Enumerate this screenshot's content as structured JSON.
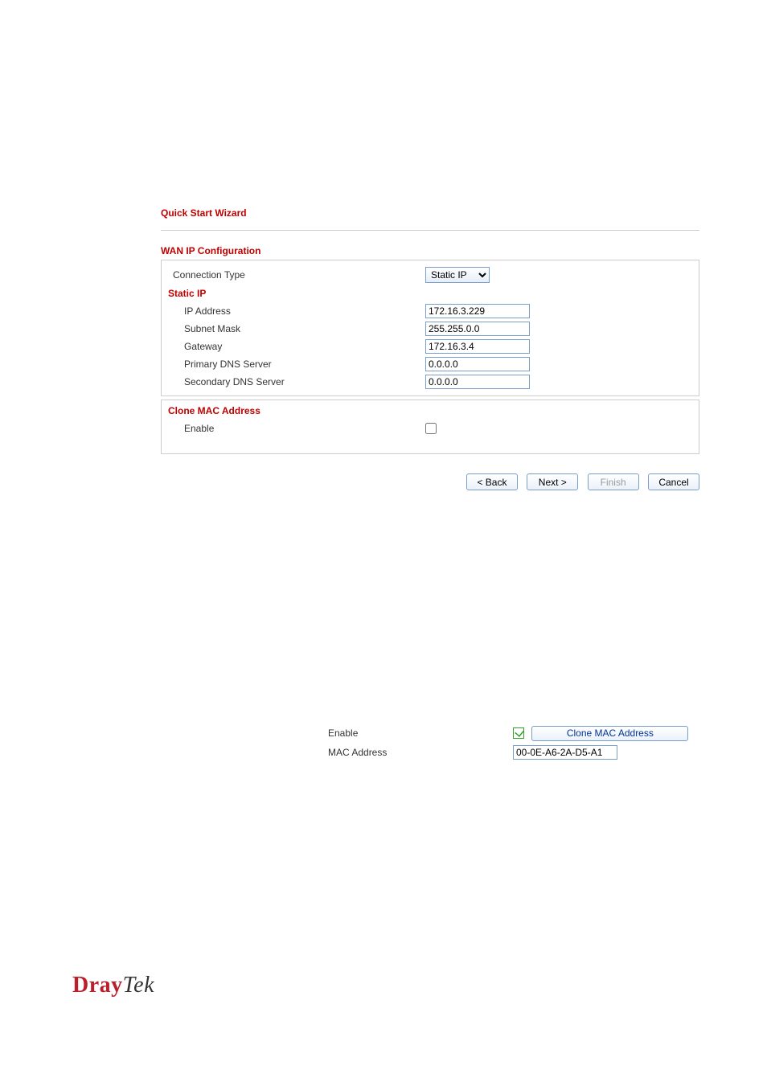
{
  "wizard": {
    "title": "Quick Start Wizard",
    "section_wan": "WAN IP Configuration",
    "conn_type_label": "Connection Type",
    "conn_type_value": "Static IP",
    "static_ip_heading": "Static IP",
    "fields": {
      "ip_label": "IP Address",
      "ip_value": "172.16.3.229",
      "mask_label": "Subnet Mask",
      "mask_value": "255.255.0.0",
      "gw_label": "Gateway",
      "gw_value": "172.16.3.4",
      "dns1_label": "Primary DNS Server",
      "dns1_value": "0.0.0.0",
      "dns2_label": "Secondary DNS Server",
      "dns2_value": "0.0.0.0"
    },
    "clone_heading": "Clone MAC Address",
    "enable_label": "Enable",
    "buttons": {
      "back": "< Back",
      "next": "Next >",
      "finish": "Finish",
      "cancel": "Cancel"
    }
  },
  "snippet": {
    "enable_label": "Enable",
    "clone_btn": "Clone MAC Address",
    "mac_label": "MAC Address",
    "mac_value": "00-0E-A6-2A-D5-A1"
  },
  "logo": {
    "bold": "Dray",
    "tek": "Tek"
  }
}
